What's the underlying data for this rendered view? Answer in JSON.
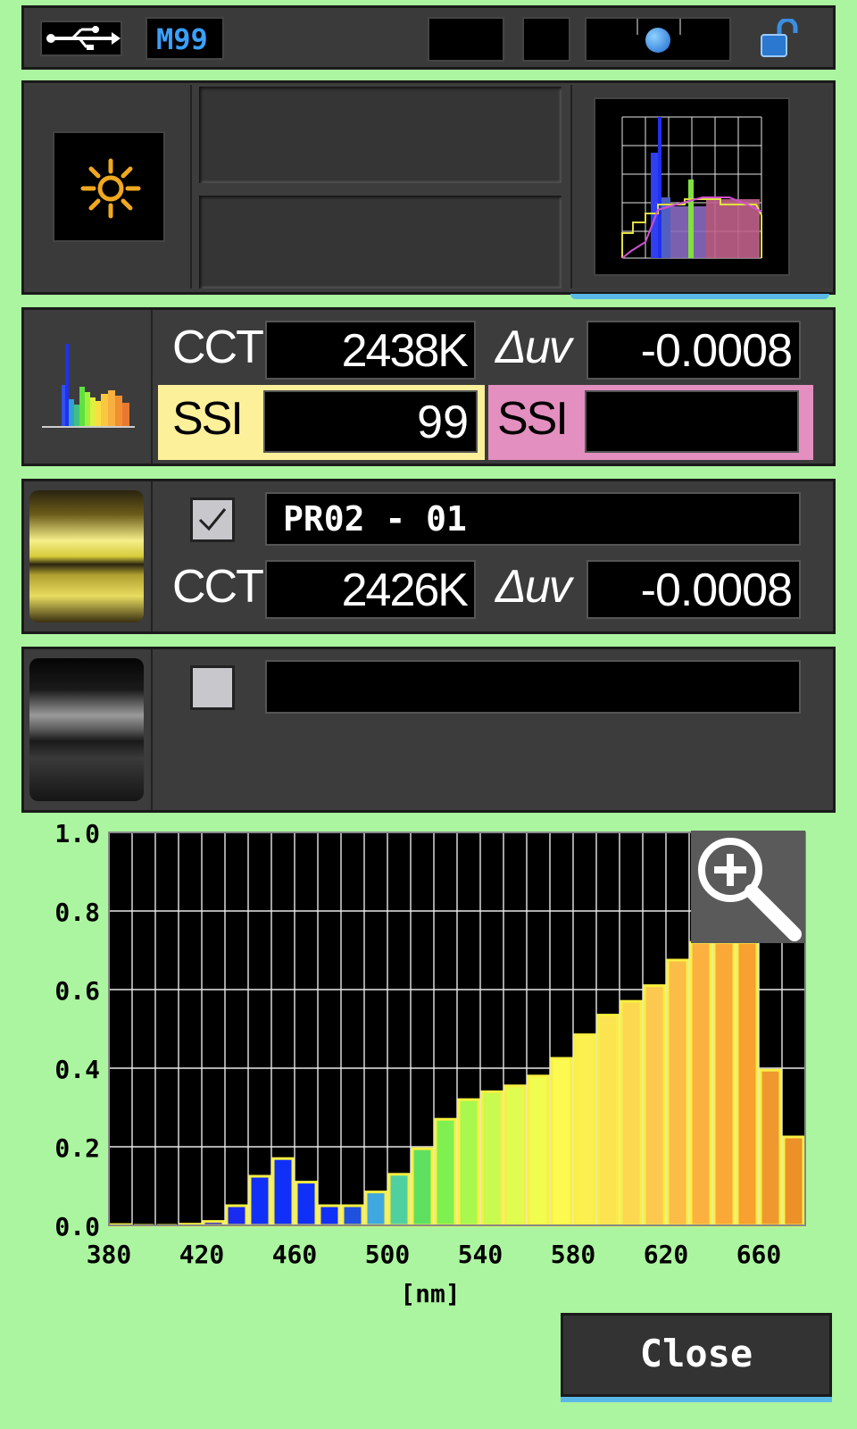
{
  "status_bar": {
    "memory_label": "M99",
    "icons": [
      "usb-icon",
      "lock-open-icon"
    ]
  },
  "mode_panel": {
    "mode_icon": "sun-icon"
  },
  "measure": {
    "cct_label": "CCT",
    "cct_value": "2438K",
    "duv_label": "Δuv",
    "duv_value": "-0.0008",
    "ssi1_label": "SSI",
    "ssi1_value": "99",
    "ssi2_label": "SSI",
    "ssi2_value": ""
  },
  "reference1": {
    "checked": true,
    "name": "PR02 - 01",
    "cct_label": "CCT",
    "cct_value": "2426K",
    "duv_label": "Δuv",
    "duv_value": "-0.0008"
  },
  "reference2": {
    "checked": false,
    "name": ""
  },
  "close_label": "Close",
  "colors": {
    "background": "#acf5a0",
    "ssi1": "#fdf09a",
    "ssi2": "#e38fc0"
  },
  "chart_data": {
    "type": "bar",
    "xlabel": "[nm]",
    "ylabel": "",
    "xlim": [
      380,
      680
    ],
    "ylim": [
      0,
      1.0
    ],
    "xticks": [
      "380",
      "420",
      "460",
      "500",
      "540",
      "580",
      "620",
      "660"
    ],
    "yticks": [
      "0.0",
      "0.2",
      "0.4",
      "0.6",
      "0.8",
      "1.0"
    ],
    "grid": true,
    "bin_width_nm": 10,
    "x": [
      380,
      390,
      400,
      410,
      420,
      430,
      440,
      450,
      460,
      470,
      480,
      490,
      500,
      510,
      520,
      530,
      540,
      550,
      560,
      570,
      580,
      590,
      600,
      610,
      620,
      630,
      640,
      650,
      660,
      670
    ],
    "values": [
      0.002,
      0.0,
      0.0,
      0.003,
      0.01,
      0.05,
      0.125,
      0.17,
      0.11,
      0.05,
      0.05,
      0.085,
      0.13,
      0.195,
      0.27,
      0.32,
      0.34,
      0.355,
      0.38,
      0.425,
      0.485,
      0.535,
      0.57,
      0.61,
      0.675,
      0.72,
      0.72,
      0.72,
      0.395,
      0.225
    ],
    "bar_colors": [
      "#2a1fd0",
      "#2a1fd0",
      "#2a1fd0",
      "#2a1fd0",
      "#2a1fd0",
      "#1a2af0",
      "#1030f8",
      "#1030f8",
      "#1030f8",
      "#1030f8",
      "#2050e0",
      "#40a8e0",
      "#50d0a0",
      "#60e060",
      "#80f050",
      "#a8f850",
      "#c8fa50",
      "#e0fc50",
      "#f0fc50",
      "#fcfa50",
      "#fcf050",
      "#fce450",
      "#fcd850",
      "#fcc850",
      "#fcbc48",
      "#fcb040",
      "#fca838",
      "#f8a030",
      "#f09830",
      "#ec9028"
    ],
    "zoom_icon": "zoom-in-icon"
  }
}
